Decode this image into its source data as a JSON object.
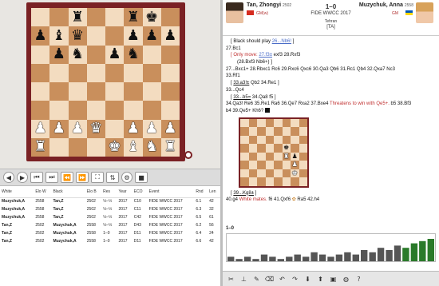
{
  "header": {
    "white": {
      "name": "Tan, Zhongyi",
      "elo": "2502",
      "title": "GM(w)"
    },
    "black": {
      "name": "Muzychuk, Anna",
      "elo": "2558",
      "title": "GM"
    },
    "result": "1–0",
    "event": "FIDE WWCC 2017",
    "site": "Tehran",
    "eco": "[TA]"
  },
  "board": [
    [
      ".",
      ".",
      "r",
      ".",
      ".",
      "r",
      "k",
      "."
    ],
    [
      "p",
      "b",
      "q",
      ".",
      ".",
      "p",
      "p",
      "p"
    ],
    [
      ".",
      "p",
      "n",
      ".",
      "p",
      "n",
      ".",
      "."
    ],
    [
      ".",
      ".",
      ".",
      ".",
      ".",
      ".",
      ".",
      "."
    ],
    [
      ".",
      ".",
      ".",
      ".",
      ".",
      ".",
      ".",
      "."
    ],
    [
      ".",
      ".",
      ".",
      ".",
      ".",
      ".",
      ".",
      "."
    ],
    [
      "P",
      "P",
      "P",
      "Q",
      ".",
      "P",
      "P",
      "P"
    ],
    [
      "R",
      ".",
      ".",
      ".",
      "K",
      "B",
      "N",
      "R"
    ]
  ],
  "mini_board": [
    [
      ".",
      ".",
      ".",
      ".",
      ".",
      ".",
      ".",
      "."
    ],
    [
      ".",
      ".",
      ".",
      ".",
      ".",
      ".",
      ".",
      "."
    ],
    [
      ".",
      ".",
      ".",
      ".",
      ".",
      ".",
      ".",
      "."
    ],
    [
      ".",
      ".",
      ".",
      ".",
      ".",
      "k",
      ".",
      "."
    ],
    [
      ".",
      ".",
      ".",
      ".",
      ".",
      "R",
      "p",
      "."
    ],
    [
      ".",
      ".",
      ".",
      ".",
      ".",
      ".",
      "P",
      "."
    ],
    [
      ".",
      ".",
      ".",
      ".",
      ".",
      ".",
      "K",
      "."
    ],
    [
      ".",
      ".",
      ".",
      ".",
      ".",
      ".",
      ".",
      "."
    ]
  ],
  "notation": {
    "l1_a": "[ Black should play ",
    "l1_b": "26...Nb6!",
    "l1_c": " ]",
    "l2": "27.Bc1",
    "l3_a": "[ Only move: ",
    "l3_b": "27.f3±",
    "l3_c": " exf3 28.Rxf3",
    "l4": "(28.Bxf3 Nb6+) ]",
    "l5": "27...Bxc1+ 28.Rbxc1 Rc6 29.Rxc6 Qxc6 30.Qa3 Qb6 31.Rc1 Qb4 32.Qxa7 Nc3",
    "l6": "33.Rf1",
    "l7_a": "[ ",
    "l7_b": "33.a3!±",
    "l7_c": " Qb2 34.Re1 ]",
    "l8": "33...Qc4",
    "l9_a": "[ ",
    "l9_b": "33...b5=",
    "l9_c": " 34.Qa8 f5 ]",
    "l10_a": "34.Qa3! Re6 35.Re1 Ra6 36.Qe7 Rxa2 37.Bxe4 ",
    "l10_b": "Threatens to win with Qe5+.",
    "l10_c": " b5 38.Bf3",
    "l11": "b4 39.Qe5+ Kh6?",
    "l12_a": "[ ",
    "l12_b": "39...Kg8±",
    "l12_c": " ]",
    "l13_a": "40.g4 ",
    "l13_b": "White mates.",
    "l13_c": " f6 41.Qxf6 ",
    "l13_d": " Ra5 42.h4"
  },
  "graph": {
    "title": "1–0",
    "bars": [
      2,
      1,
      2,
      1,
      3,
      2,
      1,
      2,
      3,
      2,
      4,
      3,
      2,
      3,
      4,
      3,
      5,
      4,
      6,
      5,
      7,
      6,
      8,
      9,
      10
    ]
  },
  "games": {
    "columns": [
      "White",
      "Elo W",
      "Black",
      "Elo B",
      "Res",
      "Year",
      "ECO",
      "Event",
      "Rnd",
      "Len"
    ],
    "rows": [
      [
        "Muzychuk,A",
        "2558",
        "Tan,Z",
        "2502",
        "½–½",
        "2017",
        "C10",
        "FIDE WWCC 2017",
        "6.1",
        "42"
      ],
      [
        "Muzychuk,A",
        "2558",
        "Tan,Z",
        "2502",
        "½–½",
        "2017",
        "C11",
        "FIDE WWCC 2017",
        "6.3",
        "32"
      ],
      [
        "Muzychuk,A",
        "2558",
        "Tan,Z",
        "2502",
        "½–½",
        "2017",
        "C42",
        "FIDE WWCC 2017",
        "6.5",
        "61"
      ],
      [
        "Tan,Z",
        "2502",
        "Muzychuk,A",
        "2558",
        "½–½",
        "2017",
        "D43",
        "FIDE WWCC 2017",
        "6.2",
        "56"
      ],
      [
        "Tan,Z",
        "2502",
        "Muzychuk,A",
        "2558",
        "1–0",
        "2017",
        "D11",
        "FIDE WWCC 2017",
        "6.4",
        "24"
      ],
      [
        "Tan,Z",
        "2502",
        "Muzychuk,A",
        "2558",
        "1–0",
        "2017",
        "D11",
        "FIDE WWCC 2017",
        "6.6",
        "42"
      ]
    ]
  },
  "nav_icons": [
    "back-icon",
    "forward-icon",
    "first-icon",
    "last-icon",
    "start-icon",
    "end-icon",
    "fullscreen-icon",
    "flip-icon",
    "engine-icon",
    "save-icon"
  ],
  "toolbar_icons": [
    "cut-icon",
    "insert-icon",
    "edit-icon",
    "eraser-icon",
    "undo-icon",
    "redo-icon",
    "download-icon",
    "upload-icon",
    "view-icon",
    "globe-icon",
    "help-icon"
  ]
}
